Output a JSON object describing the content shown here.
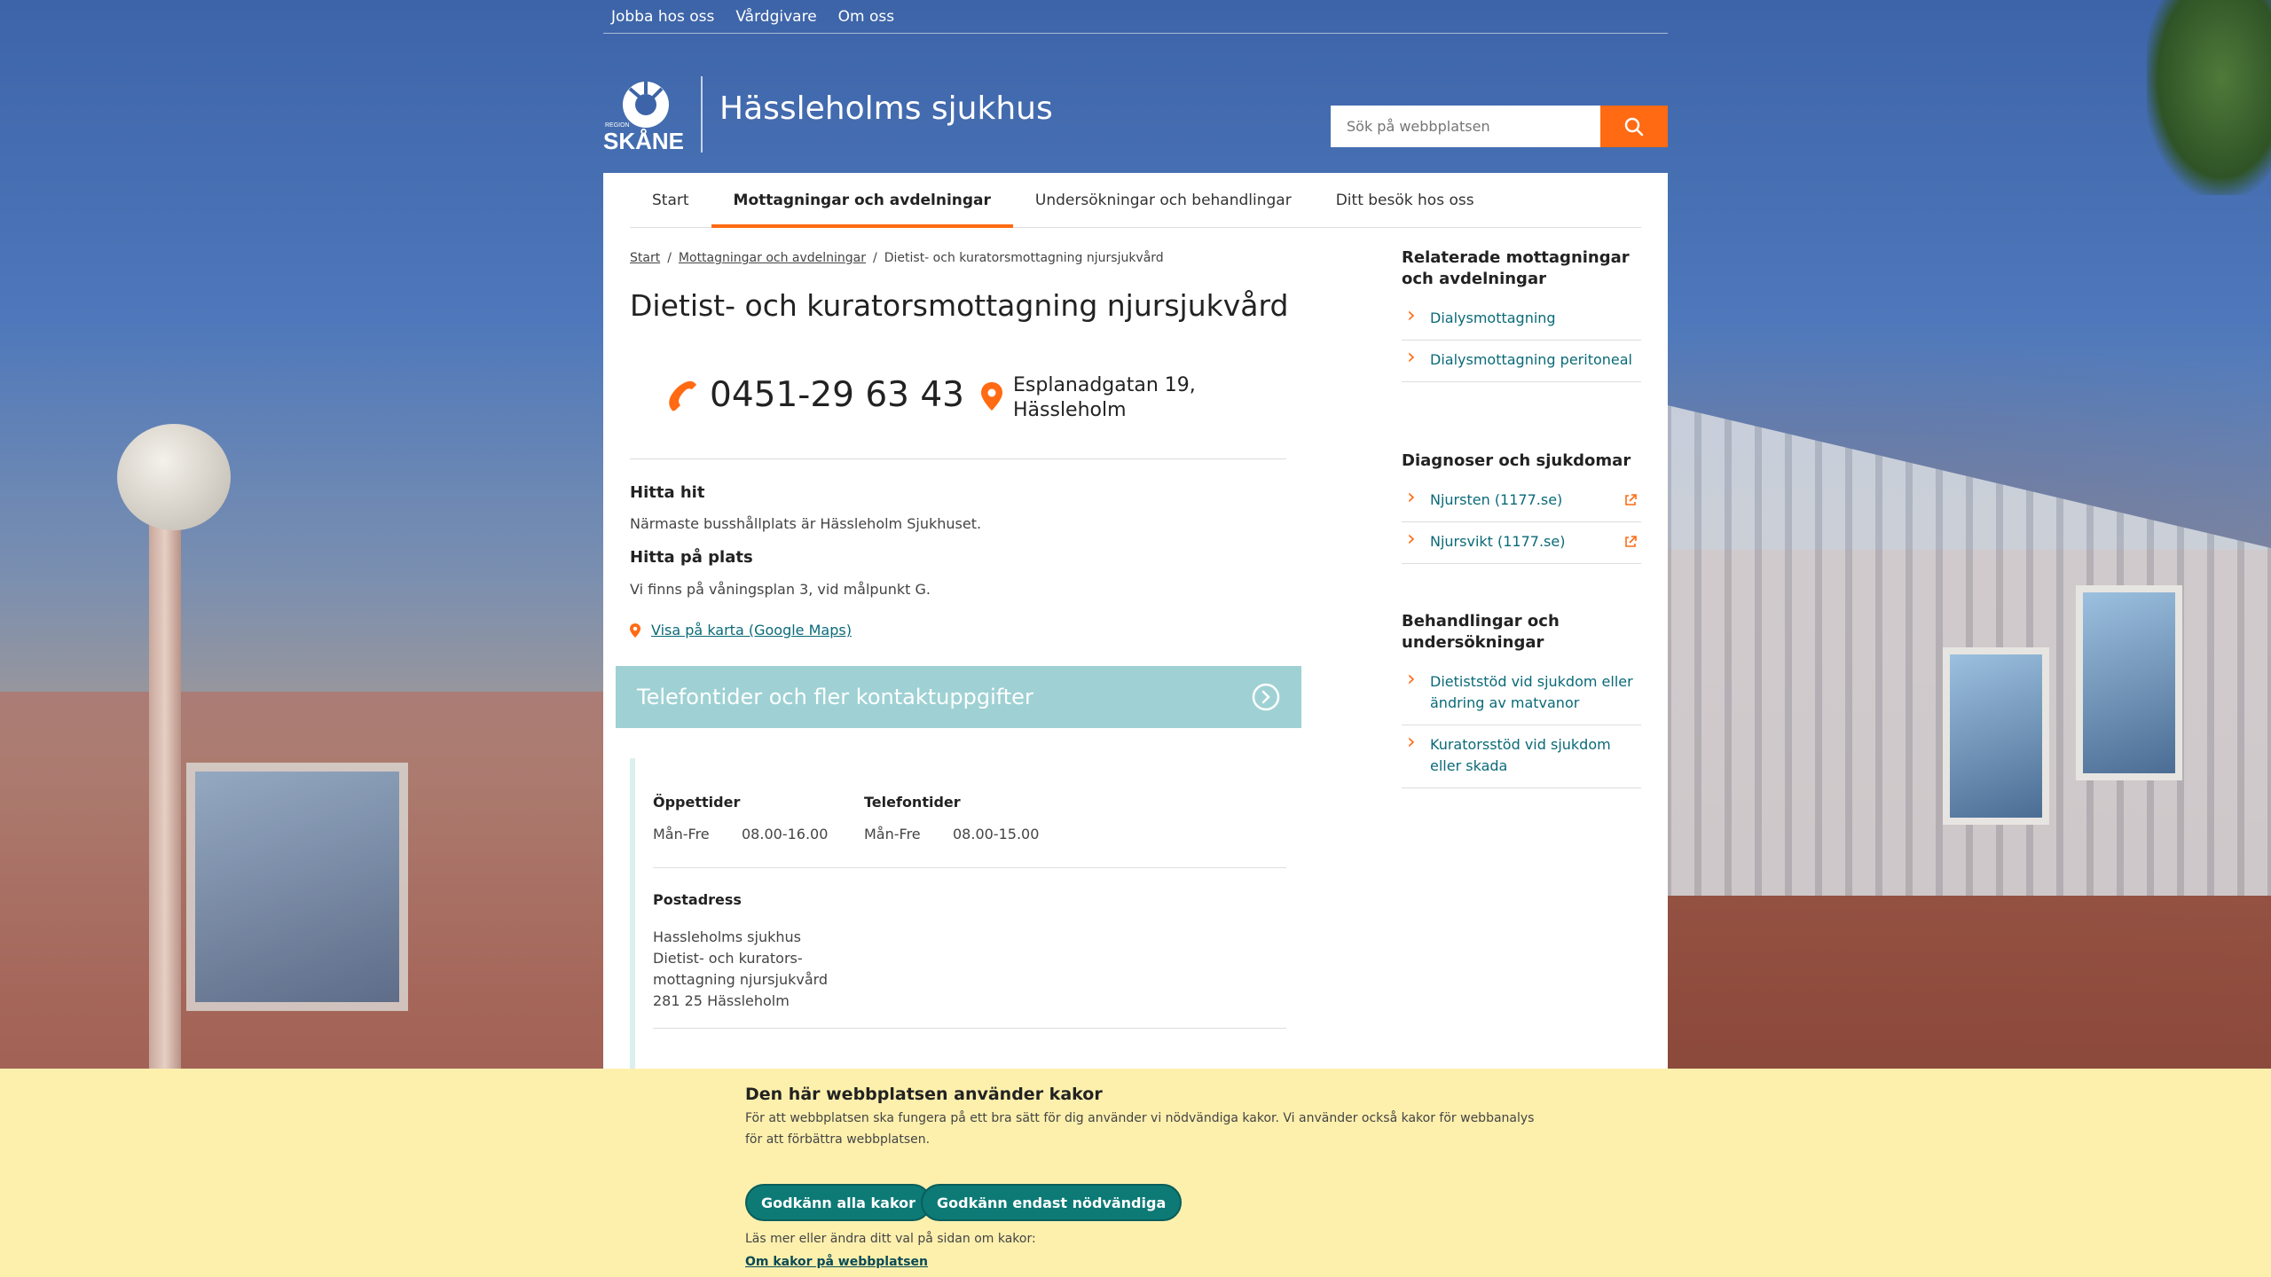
{
  "topbar": {
    "links": [
      "Jobba hos oss",
      "Vårdgivare",
      "Om oss"
    ]
  },
  "header": {
    "logo_text": "SKÅNE",
    "logo_small_text": "REGION",
    "site_title": "Hässleholms sjukhus",
    "search_placeholder": "Sök på webbplatsen"
  },
  "nav": {
    "items": [
      "Start",
      "Mottagningar och avdelningar",
      "Undersökningar och behandlingar",
      "Ditt besök hos oss"
    ],
    "active": "Mottagningar och avdelningar"
  },
  "breadcrumb": {
    "items": [
      "Start",
      "Mottagningar och avdelningar",
      "Dietist- och kuratorsmottagning njursjukvård"
    ]
  },
  "page": {
    "title": "Dietist- och kuratorsmottagning njursjukvård",
    "phone": "0451-29 63 43",
    "address_line1": "Esplanadgatan 19,",
    "address_line2": "Hässleholm",
    "find_heading": "Hitta hit",
    "find_text": "Närmaste busshållplats är Hässleholm Sjukhuset.",
    "find_place_heading": "Hitta på plats",
    "find_place_text": "Vi finns på våningsplan 3, vid målpunkt G.",
    "map_link": "Visa på karta (Google Maps)",
    "accordion_label": "Telefontider och fler kontaktuppgifter"
  },
  "contact": {
    "opening_label": "Öppettider",
    "opening_days": "Mån-Fre",
    "opening_hours": "08.00-16.00",
    "phone_label": "Telefontider",
    "phone_days": "Mån-Fre",
    "phone_hours": "08.00-15.00",
    "postal_label": "Postadress",
    "postal_lines": [
      "Hassleholms sjukhus",
      "Dietist- och kurators-",
      "mottagning njursjukvård",
      "281 25 Hässleholm"
    ]
  },
  "sidebar": {
    "related": {
      "heading": "Relaterade mottagningar och avdelningar",
      "items": [
        "Dialysmottagning",
        "Dialysmottagning peritoneal"
      ]
    },
    "diagnoses": {
      "heading": "Diagnoser och sjukdomar",
      "items": [
        "Njursten (1177.se)",
        "Njursvikt (1177.se)"
      ]
    },
    "treatments": {
      "heading": "Behandlingar och undersökningar",
      "items": [
        "Dietiststöd vid sjukdom eller ändring av matvanor",
        "Kuratorsstöd vid sjukdom eller skada"
      ]
    }
  },
  "cookie": {
    "title": "Den här webbplatsen använder kakor",
    "text": "För att webbplatsen ska fungera på ett bra sätt för dig använder vi nödvändiga kakor. Vi använder också kakor för webbanalys för att förbättra webbplatsen.",
    "accept_all": "Godkänn alla kakor",
    "accept_necessary": "Godkänn endast nödvändiga",
    "more_text": "Läs mer eller ändra ditt val på sidan om kakor:",
    "more_link": "Om kakor på webbplatsen"
  },
  "colors": {
    "accent": "#ff6a13",
    "teal_link": "#0a6a78",
    "accordion": "#9fd1d4",
    "cookie_bg": "#fdf0ad",
    "cookie_btn": "#0d7a76"
  }
}
